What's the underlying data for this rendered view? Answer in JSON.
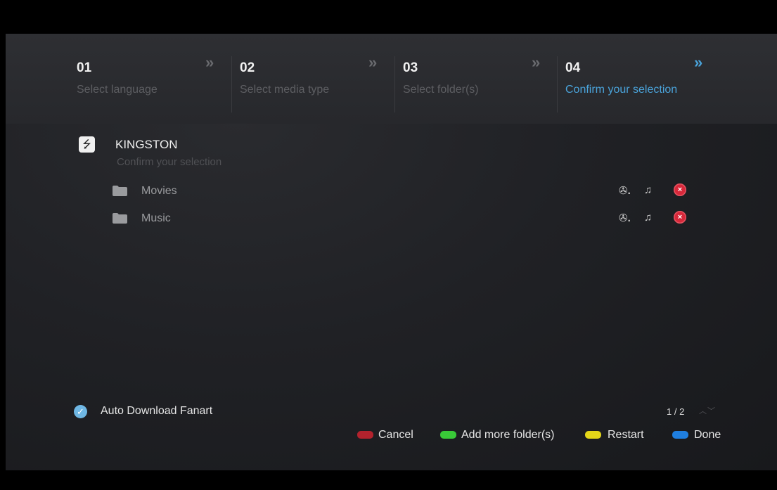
{
  "steps": [
    {
      "num": "01",
      "label": "Select language",
      "active": false
    },
    {
      "num": "02",
      "label": "Select media type",
      "active": false
    },
    {
      "num": "03",
      "label": "Select folder(s)",
      "active": false
    },
    {
      "num": "04",
      "label": "Confirm your selection",
      "active": true
    }
  ],
  "step_arrow": "»",
  "device": {
    "name": "KINGSTON",
    "subtitle": "Confirm your selection",
    "icon": "usb-icon"
  },
  "folders": [
    {
      "name": "Movies",
      "icons": [
        "film-reel-icon",
        "music-note-icon",
        "remove-icon"
      ]
    },
    {
      "name": "Music",
      "icons": [
        "film-reel-icon",
        "music-note-icon",
        "remove-icon"
      ]
    }
  ],
  "auto_download": {
    "label": "Auto Download Fanart",
    "checked": true
  },
  "pager": {
    "text": "1 / 2"
  },
  "legend": [
    {
      "label": "Cancel",
      "color": "#b3222d"
    },
    {
      "label": "Add more folder(s)",
      "color": "#39c938"
    },
    {
      "label": "Restart",
      "color": "#e4d619"
    },
    {
      "label": "Done",
      "color": "#1f7fe0"
    }
  ],
  "colors": {
    "accent": "#4aa3da",
    "remove": "#d8283a"
  }
}
